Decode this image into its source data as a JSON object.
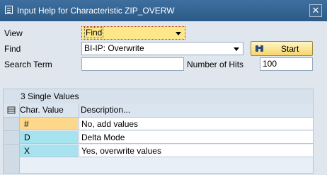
{
  "window": {
    "title": "Input Help for Characteristic ZIP_OVERW",
    "close_label": "✕"
  },
  "form": {
    "view_label": "View",
    "view_value": "Find",
    "find_label": "Find",
    "find_value": "BI-IP: Overwrite",
    "start_label": "Start",
    "search_term_label": "Search Term",
    "search_term_value": "",
    "number_of_hits_label": "Number of Hits",
    "number_of_hits_value": "100"
  },
  "results": {
    "title": "3  Single Values",
    "columns": [
      "Char. Value",
      "Description..."
    ],
    "rows": [
      {
        "value": "#",
        "description": "No, add values"
      },
      {
        "value": "D",
        "description": "Delta Mode"
      },
      {
        "value": "X",
        "description": "Yes, overwrite values"
      }
    ]
  },
  "colors": {
    "title_bar": "#2c5a87",
    "focus_field": "#fde889",
    "value_cell": "#a7e2ef",
    "highlight_cell": "#fdd78a"
  }
}
